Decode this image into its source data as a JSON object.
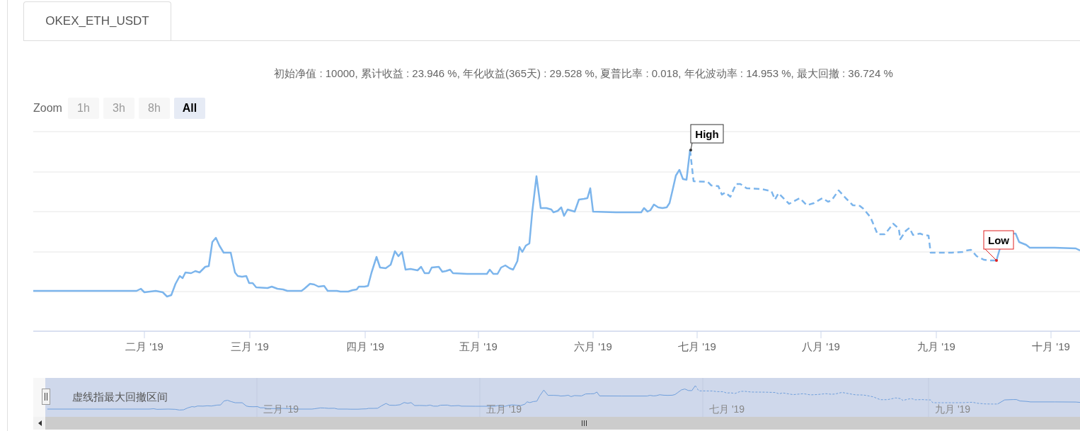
{
  "tab": {
    "label": "OKEX_ETH_USDT",
    "selected": true
  },
  "summary": "初始净值 : 10000, 累计收益 : 23.946 %, 年化收益(365天) : 29.528 %, 夏普比率 : 0.018, 年化波动率 : 14.953 %, 最大回撤 : 36.724 %",
  "zoom": {
    "label": "Zoom",
    "buttons": [
      {
        "label": "1h",
        "selected": false,
        "disabled": true
      },
      {
        "label": "3h",
        "selected": false,
        "disabled": true
      },
      {
        "label": "8h",
        "selected": false,
        "disabled": true
      },
      {
        "label": "All",
        "selected": true,
        "disabled": false
      }
    ]
  },
  "chart": {
    "flags": [
      {
        "label": "High",
        "kind": "high"
      },
      {
        "label": "Low",
        "kind": "low"
      }
    ],
    "x_labels": [
      "二月 '19",
      "三月 '19",
      "四月 '19",
      "五月 '19",
      "六月 '19",
      "七月 '19",
      "八月 '19",
      "九月 '19",
      "十月 '19"
    ]
  },
  "navigator": {
    "note": "虚线指最大回撤区间",
    "x_labels": [
      "三月 '19",
      "五月 '19",
      "七月 '19",
      "九月 '19"
    ]
  }
}
